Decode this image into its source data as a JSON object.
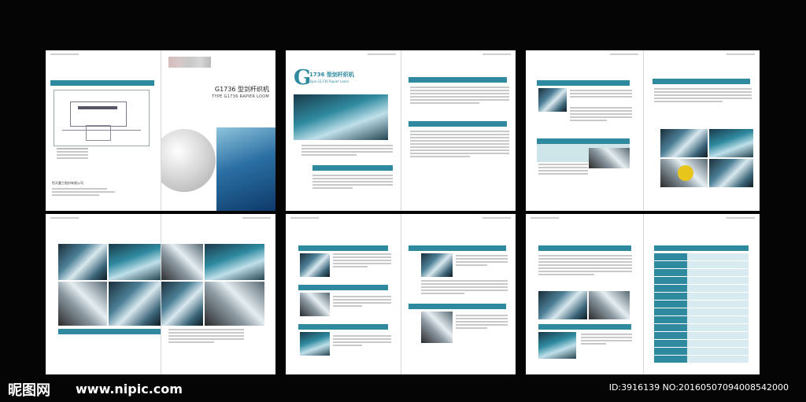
{
  "cover": {
    "title_cn": "G1736 型剑杆织机",
    "title_en": "TYPE G1736 RAPIER LOOM",
    "company": "恒天重工股份有限公司"
  },
  "brochure": {
    "big_letter": "G",
    "model_title": "1736 型剑杆织机",
    "model_subtitle": "Type G1736 Rapier Loom"
  },
  "watermark": {
    "logo_text": "昵图网",
    "url": "www.nipic.com",
    "id_text": "ID:3916139 NO:20160507094008542000"
  },
  "colors": {
    "accent": "#2f8aa0",
    "accent_light": "#9cc9d4",
    "background": "#050505"
  }
}
